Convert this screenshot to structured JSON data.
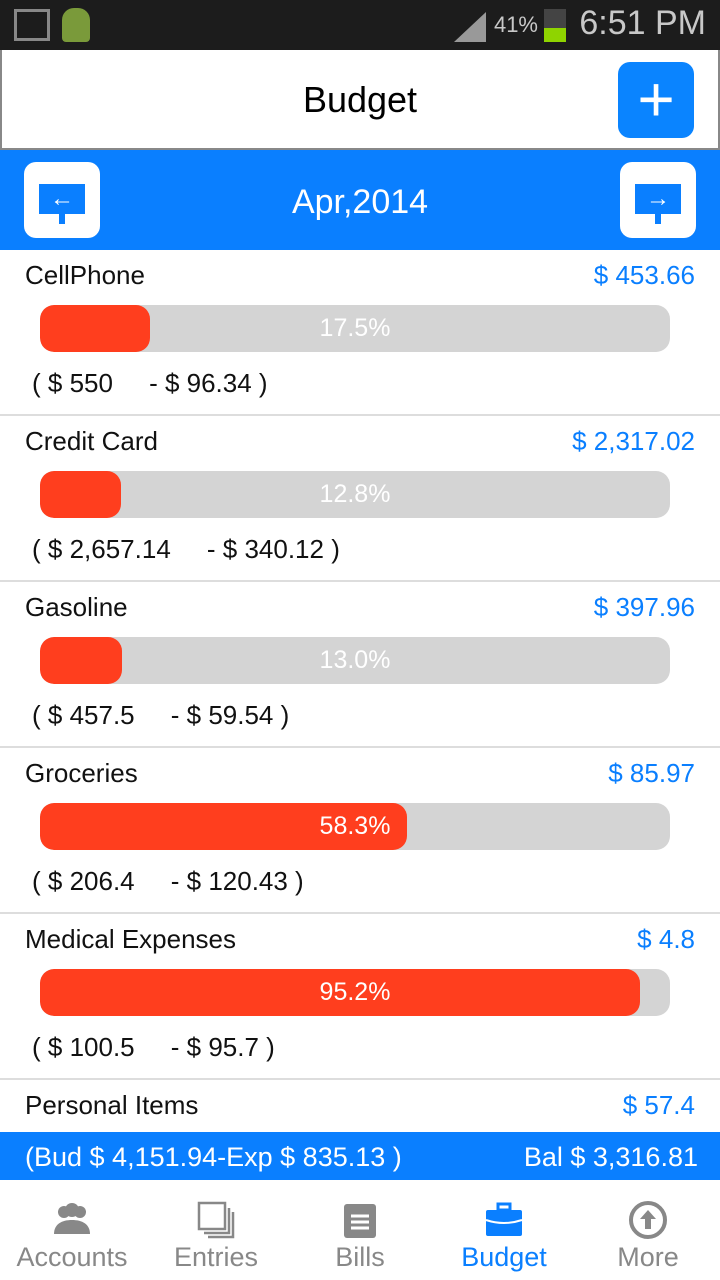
{
  "status": {
    "battery": "41%",
    "time": "6:51 PM"
  },
  "header": {
    "title": "Budget",
    "add_icon": "plus-icon"
  },
  "month": {
    "label": "Apr,2014",
    "prev_icon": "arrow-left-sign-icon",
    "next_icon": "arrow-right-sign-icon"
  },
  "colors": {
    "accent": "#0a7fff",
    "bar_fill": "#ff3e1e",
    "bar_track": "#d4d4d4"
  },
  "items": [
    {
      "name": "CellPhone",
      "balance": "$ 453.66",
      "percent_label": "17.5%",
      "percent": 17.5,
      "range": "( $ 550     - $ 96.34 )"
    },
    {
      "name": "Credit Card",
      "balance": "$ 2,317.02",
      "percent_label": "12.8%",
      "percent": 12.8,
      "range": "( $ 2,657.14     - $ 340.12 )"
    },
    {
      "name": "Gasoline",
      "balance": "$ 397.96",
      "percent_label": "13.0%",
      "percent": 13.0,
      "range": "( $ 457.5     - $ 59.54 )"
    },
    {
      "name": "Groceries",
      "balance": "$ 85.97",
      "percent_label": "58.3%",
      "percent": 58.3,
      "range": "( $ 206.4     - $ 120.43 )"
    },
    {
      "name": "Medical Expenses",
      "balance": "$ 4.8",
      "percent_label": "95.2%",
      "percent": 95.2,
      "range": "( $ 100.5     - $ 95.7 )"
    },
    {
      "name": "Personal Items",
      "balance": "$ 57.4"
    }
  ],
  "summary": {
    "left": "(Bud $ 4,151.94-Exp $ 835.13 )",
    "right": "Bal $ 3,316.81"
  },
  "tabs": [
    {
      "label": "Accounts",
      "icon": "people-icon"
    },
    {
      "label": "Entries",
      "icon": "stacked-pages-icon"
    },
    {
      "label": "Bills",
      "icon": "notepad-icon"
    },
    {
      "label": "Budget",
      "icon": "briefcase-icon",
      "active": true
    },
    {
      "label": "More",
      "icon": "circle-up-arrow-icon"
    }
  ]
}
